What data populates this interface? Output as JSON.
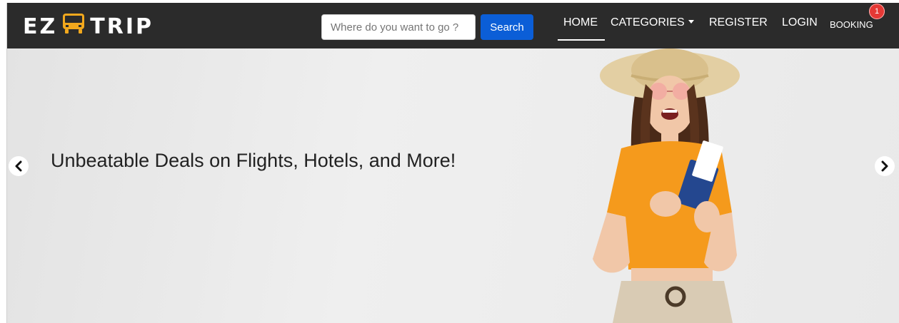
{
  "brand": {
    "logo_left": "EZ",
    "logo_right": "TRIP"
  },
  "search": {
    "placeholder": "Where do you want to go ?",
    "button_label": "Search"
  },
  "nav": {
    "home": "HOME",
    "categories": "CATEGORIES",
    "register": "REGISTER",
    "login": "LOGIN",
    "booking": "BOOKING",
    "booking_count": "1"
  },
  "hero": {
    "title": "Unbeatable Deals on Flights, Hotels, and More!",
    "prev_icon": "chevron-left-icon",
    "next_icon": "chevron-right-icon"
  },
  "colors": {
    "navbar_bg": "#2b2b2b",
    "search_button": "#0b5ed7",
    "badge": "#e53935",
    "bus_icon": "#f2a81d"
  }
}
